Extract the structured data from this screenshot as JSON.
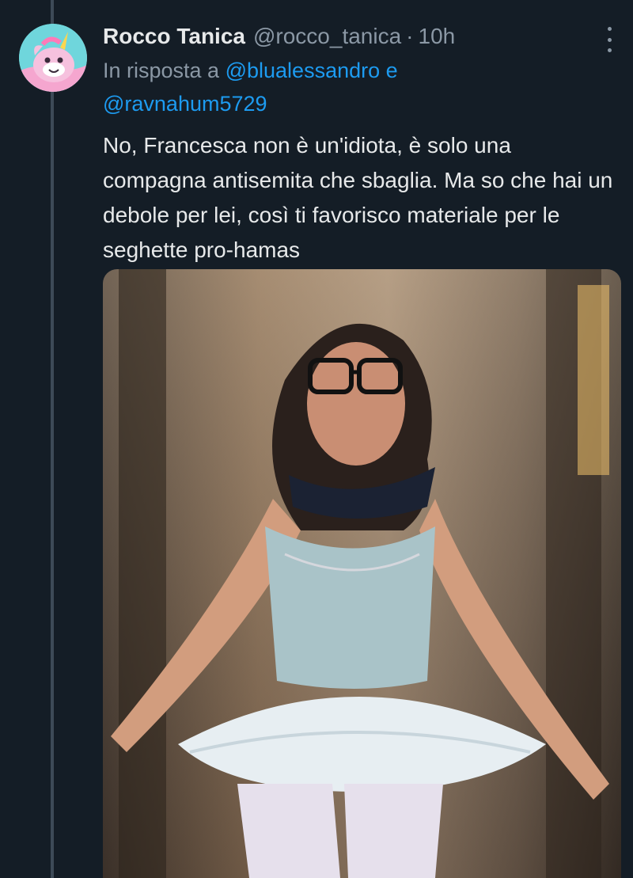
{
  "tweet": {
    "display_name": "Rocco Tanica",
    "handle": "@rocco_tanica",
    "separator": "·",
    "time": "10h",
    "reply_prefix": "In risposta a",
    "reply_mention_1": "@blualessandro",
    "reply_joiner": "e",
    "reply_mention_2": "@ravnahum5729",
    "text": "No, Francesca non è un'idiota, è solo una compagna antisemita che sbaglia. Ma so che hai un debole per lei, così ti favorisco materiale per le seghette pro-hamas"
  },
  "icons": {
    "more": "more-vertical-icon",
    "avatar": "unicorn-avatar"
  },
  "colors": {
    "background": "#141d26",
    "text": "#e7e9ea",
    "muted": "#8b98a5",
    "link": "#1d9bf0",
    "thread_line": "#3d4a57"
  }
}
